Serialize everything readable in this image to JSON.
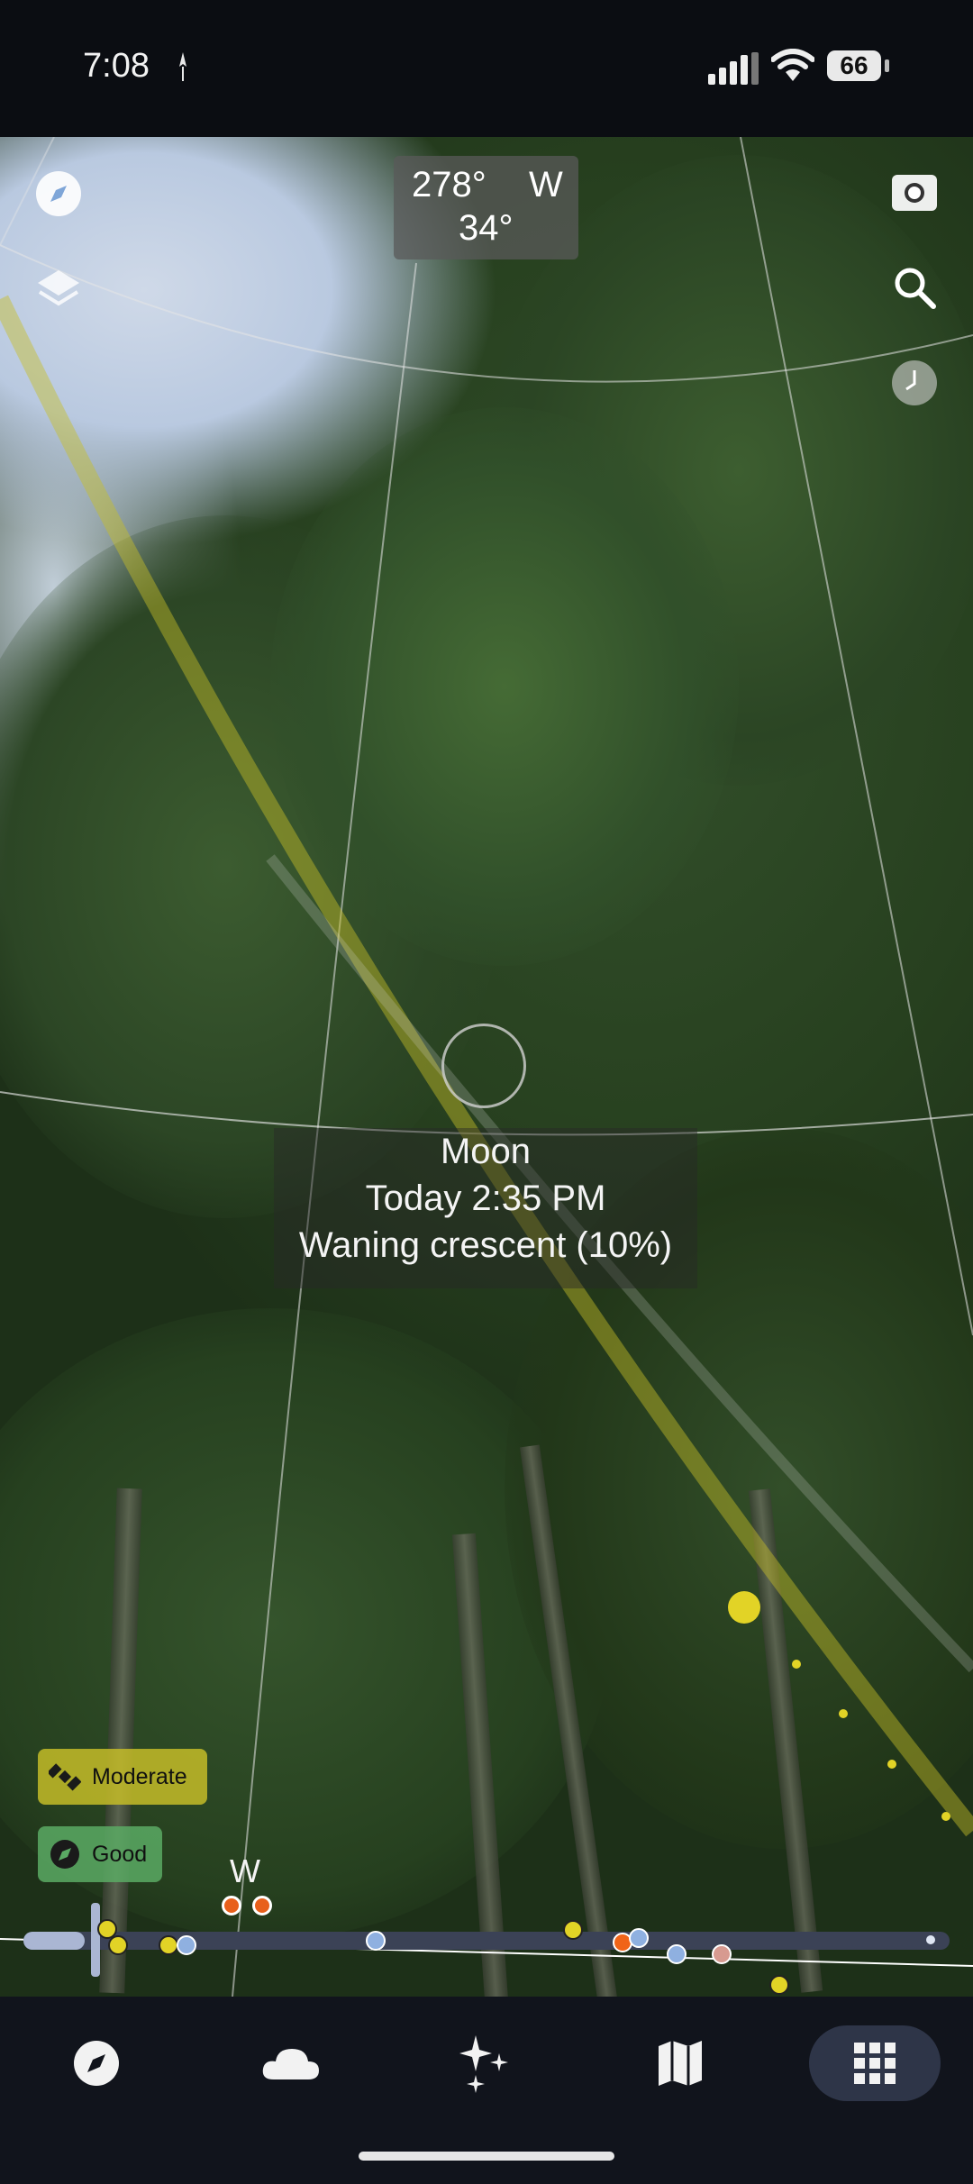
{
  "status_bar": {
    "time": "7:08",
    "battery": "66",
    "icons": [
      "navigation-arrow-icon",
      "signal-icon",
      "wifi-icon",
      "battery-icon"
    ]
  },
  "heading": {
    "azimuth": "278°",
    "direction": "W",
    "altitude": "34°"
  },
  "overlay_controls": {
    "left": [
      "compass-icon",
      "layers-icon"
    ],
    "right": [
      "camera-icon",
      "search-icon",
      "clock-icon"
    ]
  },
  "moon_info": {
    "name": "Moon",
    "time": "Today 2:35 PM",
    "phase": "Waning crescent (10%)"
  },
  "quality_badges": [
    {
      "label": "Moderate",
      "icon": "satellite-icon",
      "color": "#c4bc28"
    },
    {
      "label": "Good",
      "icon": "compass-icon",
      "color": "#5aaa64"
    }
  ],
  "compass_direction_label": "W",
  "timeline": {
    "progress_fraction": 0.07,
    "markers": [
      "sun-icon",
      "moon-icon",
      "haze-icon",
      "sun-icon",
      "sun-dot",
      "camera-icon",
      "person-icon",
      "sun-icon"
    ]
  },
  "bottom_nav": {
    "items": [
      {
        "name": "compass",
        "icon": "compass-icon",
        "active": false
      },
      {
        "name": "weather",
        "icon": "cloud-icon",
        "active": false
      },
      {
        "name": "night-sky",
        "icon": "sparkles-icon",
        "active": false
      },
      {
        "name": "map",
        "icon": "map-icon",
        "active": false
      },
      {
        "name": "apps",
        "icon": "grid-icon",
        "active": true
      }
    ]
  },
  "colors": {
    "sun_path": "#d8cc2a",
    "active_nav": "#2e3548",
    "timeline_track": "#3b4256"
  }
}
